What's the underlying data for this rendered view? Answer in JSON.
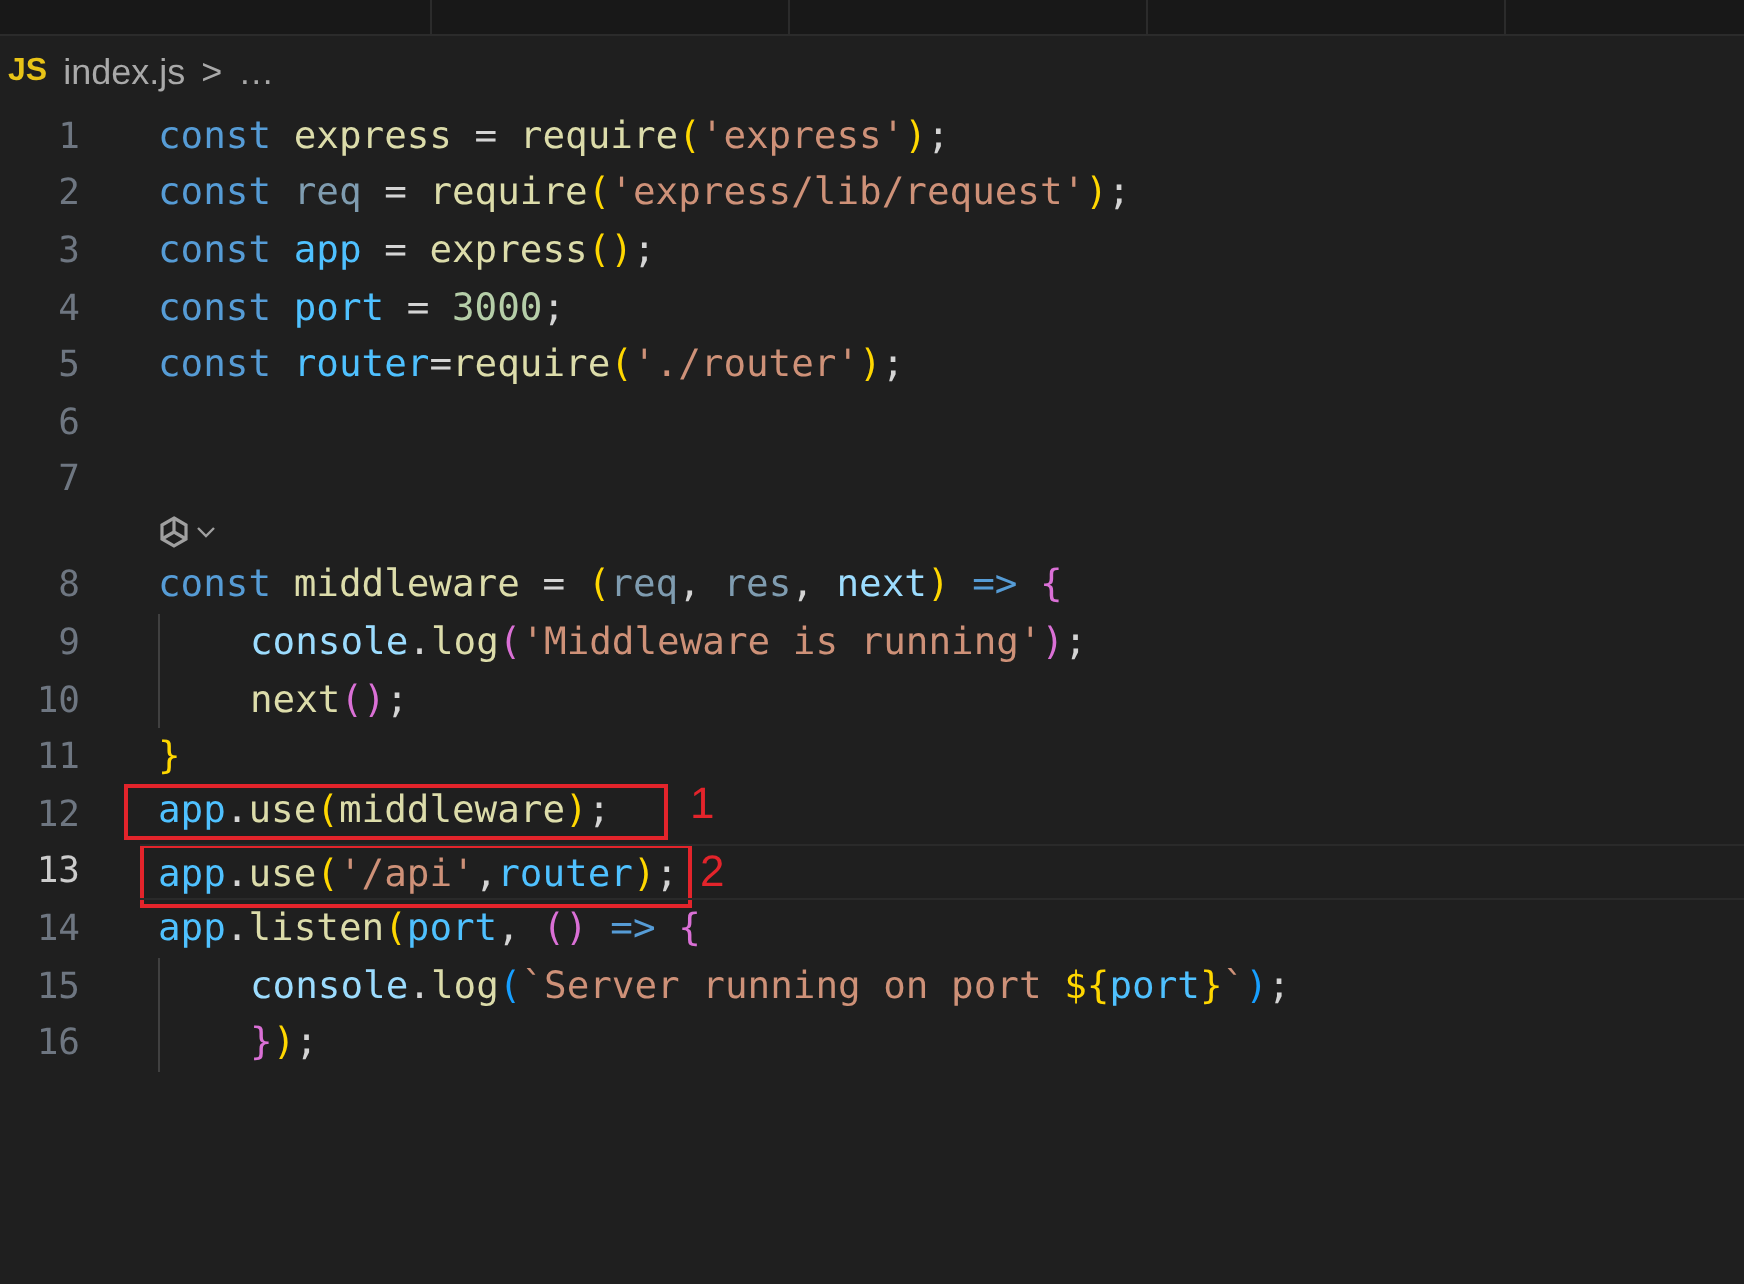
{
  "breadcrumb": {
    "file_badge": "JS",
    "file": "index.js",
    "separator": ">",
    "more": "…"
  },
  "lines": [
    {
      "number": "1",
      "current": false,
      "tokens": [
        {
          "kind": "keyword",
          "text": "const "
        },
        {
          "kind": "fn",
          "text": "express"
        },
        {
          "kind": "plain",
          "text": " = "
        },
        {
          "kind": "fn",
          "text": "require"
        },
        {
          "kind": "b1",
          "text": "("
        },
        {
          "kind": "string",
          "text": "'express'"
        },
        {
          "kind": "b1",
          "text": ")"
        },
        {
          "kind": "plain",
          "text": ";"
        }
      ]
    },
    {
      "number": "2",
      "current": false,
      "tokens": [
        {
          "kind": "keyword",
          "text": "const "
        },
        {
          "kind": "unused",
          "text": "req"
        },
        {
          "kind": "plain",
          "text": " = "
        },
        {
          "kind": "fn",
          "text": "require"
        },
        {
          "kind": "b1",
          "text": "("
        },
        {
          "kind": "string",
          "text": "'express/lib/request'"
        },
        {
          "kind": "b1",
          "text": ")"
        },
        {
          "kind": "plain",
          "text": ";"
        }
      ]
    },
    {
      "number": "3",
      "current": false,
      "tokens": [
        {
          "kind": "keyword",
          "text": "const "
        },
        {
          "kind": "const",
          "text": "app"
        },
        {
          "kind": "plain",
          "text": " = "
        },
        {
          "kind": "fn",
          "text": "express"
        },
        {
          "kind": "b1",
          "text": "()"
        },
        {
          "kind": "plain",
          "text": ";"
        }
      ]
    },
    {
      "number": "4",
      "current": false,
      "tokens": [
        {
          "kind": "keyword",
          "text": "const "
        },
        {
          "kind": "const",
          "text": "port"
        },
        {
          "kind": "plain",
          "text": " = "
        },
        {
          "kind": "number",
          "text": "3000"
        },
        {
          "kind": "plain",
          "text": ";"
        }
      ]
    },
    {
      "number": "5",
      "current": false,
      "tokens": [
        {
          "kind": "keyword",
          "text": "const "
        },
        {
          "kind": "const",
          "text": "router"
        },
        {
          "kind": "plain",
          "text": "="
        },
        {
          "kind": "fn",
          "text": "require"
        },
        {
          "kind": "b1",
          "text": "("
        },
        {
          "kind": "string",
          "text": "'./router'"
        },
        {
          "kind": "b1",
          "text": ")"
        },
        {
          "kind": "plain",
          "text": ";"
        }
      ]
    },
    {
      "number": "6",
      "current": false
    },
    {
      "number": "7",
      "current": false,
      "codelens": true
    },
    {
      "number": "8",
      "current": false,
      "tokens": [
        {
          "kind": "keyword",
          "text": "const "
        },
        {
          "kind": "fn",
          "text": "middleware"
        },
        {
          "kind": "plain",
          "text": " = "
        },
        {
          "kind": "b1",
          "text": "("
        },
        {
          "kind": "unused",
          "text": "req"
        },
        {
          "kind": "plain",
          "text": ", "
        },
        {
          "kind": "unused",
          "text": "res"
        },
        {
          "kind": "plain",
          "text": ", "
        },
        {
          "kind": "var",
          "text": "next"
        },
        {
          "kind": "b1",
          "text": ")"
        },
        {
          "kind": "keyword",
          "text": " => "
        },
        {
          "kind": "b2",
          "text": "{"
        }
      ]
    },
    {
      "number": "9",
      "current": false,
      "indented": true,
      "tokens": [
        {
          "kind": "var",
          "text": "console"
        },
        {
          "kind": "plain",
          "text": "."
        },
        {
          "kind": "fn",
          "text": "log"
        },
        {
          "kind": "b2",
          "text": "("
        },
        {
          "kind": "string",
          "text": "'Middleware is running'"
        },
        {
          "kind": "b2",
          "text": ")"
        },
        {
          "kind": "plain",
          "text": ";"
        }
      ]
    },
    {
      "number": "10",
      "current": false,
      "indented": true,
      "tokens": [
        {
          "kind": "fn",
          "text": "next"
        },
        {
          "kind": "b2",
          "text": "()"
        },
        {
          "kind": "plain",
          "text": ";"
        }
      ]
    },
    {
      "number": "11",
      "current": false,
      "tokens": [
        {
          "kind": "b1",
          "text": "}"
        }
      ]
    },
    {
      "number": "12",
      "current": false,
      "annotation": "1",
      "tokens": [
        {
          "kind": "const",
          "text": "app"
        },
        {
          "kind": "plain",
          "text": "."
        },
        {
          "kind": "fn",
          "text": "use"
        },
        {
          "kind": "b1",
          "text": "("
        },
        {
          "kind": "fn",
          "text": "middleware"
        },
        {
          "kind": "b1",
          "text": ")"
        },
        {
          "kind": "plain",
          "text": ";"
        }
      ]
    },
    {
      "number": "13",
      "current": true,
      "annotation": "2",
      "tokens": [
        {
          "kind": "const",
          "text": "app"
        },
        {
          "kind": "plain",
          "text": "."
        },
        {
          "kind": "fn",
          "text": "use"
        },
        {
          "kind": "b1",
          "text": "("
        },
        {
          "kind": "string",
          "text": "'/api'"
        },
        {
          "kind": "plain",
          "text": ","
        },
        {
          "kind": "const",
          "text": "router"
        },
        {
          "kind": "b1",
          "text": ")"
        },
        {
          "kind": "plain",
          "text": ";"
        }
      ]
    },
    {
      "number": "14",
      "current": false,
      "tokens": [
        {
          "kind": "const",
          "text": "app"
        },
        {
          "kind": "plain",
          "text": "."
        },
        {
          "kind": "fn",
          "text": "listen"
        },
        {
          "kind": "b1",
          "text": "("
        },
        {
          "kind": "const",
          "text": "port"
        },
        {
          "kind": "plain",
          "text": ", "
        },
        {
          "kind": "b2",
          "text": "()"
        },
        {
          "kind": "keyword",
          "text": " => "
        },
        {
          "kind": "b2",
          "text": "{"
        }
      ]
    },
    {
      "number": "15",
      "current": false,
      "indented": true,
      "tokens": [
        {
          "kind": "var",
          "text": "console"
        },
        {
          "kind": "plain",
          "text": "."
        },
        {
          "kind": "fn",
          "text": "log"
        },
        {
          "kind": "b3",
          "text": "("
        },
        {
          "kind": "string",
          "text": "`Server running on port "
        },
        {
          "kind": "b1",
          "text": "${"
        },
        {
          "kind": "const",
          "text": "port"
        },
        {
          "kind": "b1",
          "text": "}"
        },
        {
          "kind": "string",
          "text": "`"
        },
        {
          "kind": "b3",
          "text": ")"
        },
        {
          "kind": "plain",
          "text": ";"
        }
      ]
    },
    {
      "number": "16",
      "current": false,
      "indented": true,
      "tokens": [
        {
          "kind": "b2",
          "text": "}"
        },
        {
          "kind": "b1",
          "text": ")"
        },
        {
          "kind": "plain",
          "text": ";"
        }
      ]
    }
  ]
}
